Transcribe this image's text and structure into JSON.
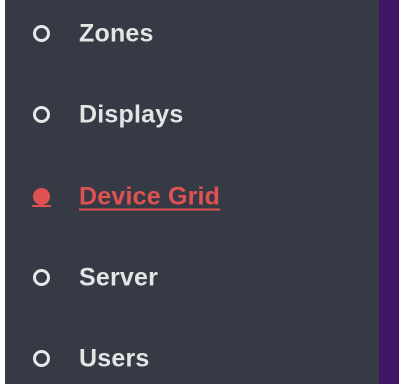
{
  "sidebar": {
    "items": [
      {
        "label": "Zones",
        "icon": "circle-outline-icon",
        "active": false
      },
      {
        "label": "Displays",
        "icon": "circle-outline-icon",
        "active": false
      },
      {
        "label": "Device Grid",
        "icon": "circle-filled-icon",
        "active": true
      },
      {
        "label": "Server",
        "icon": "circle-outline-icon",
        "active": false
      },
      {
        "label": "Users",
        "icon": "circle-outline-icon",
        "active": false
      }
    ]
  },
  "colors": {
    "sidebar_background": "#353a45",
    "text": "#e4e4e4",
    "active_accent": "#e05252",
    "adjacent_panel": "#3e1663"
  }
}
